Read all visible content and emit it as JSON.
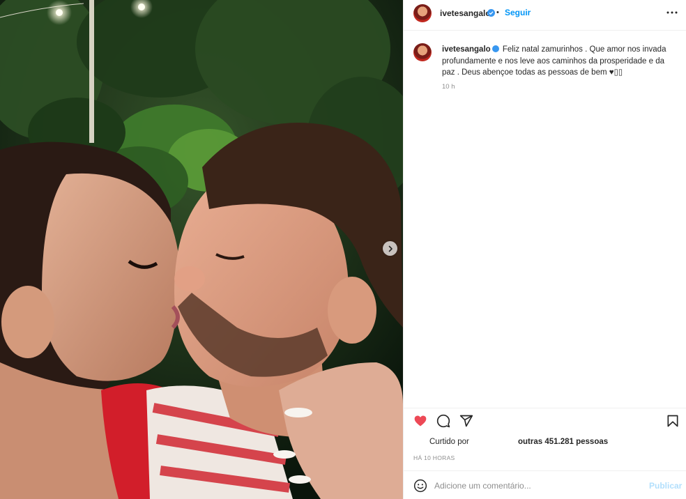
{
  "post": {
    "username": "ivetesangalo",
    "verified": true,
    "separator": "•",
    "follow_label": "Seguir",
    "more_icon": "more-options-icon",
    "next_icon": "chevron-right-icon"
  },
  "caption": {
    "username": "ivetesangalo",
    "text": "Feliz natal zamurinhos . Que amor nos invada profundamente e nos leve aos caminhos da prosperidade e da paz . Deus abençoe todas as pessoas de bem ♥▯▯",
    "time": "10 h"
  },
  "actions": {
    "like_icon": "heart-icon",
    "comment_icon": "comment-icon",
    "share_icon": "share-icon",
    "save_icon": "bookmark-icon",
    "liked": true,
    "like_color": "#ed4956"
  },
  "likes": {
    "prefix": "Curtido por",
    "suffix": "outras 451.281 pessoas"
  },
  "posted_ago": "HÁ 10 HORAS",
  "comment": {
    "emoji_icon": "emoji-icon",
    "placeholder": "Adicione um comentário...",
    "publish_label": "Publicar"
  },
  "colors": {
    "accent": "#0095f6",
    "publish_disabled": "#b2dffc",
    "muted": "#8e8e8e",
    "verified": "#3897f0"
  }
}
